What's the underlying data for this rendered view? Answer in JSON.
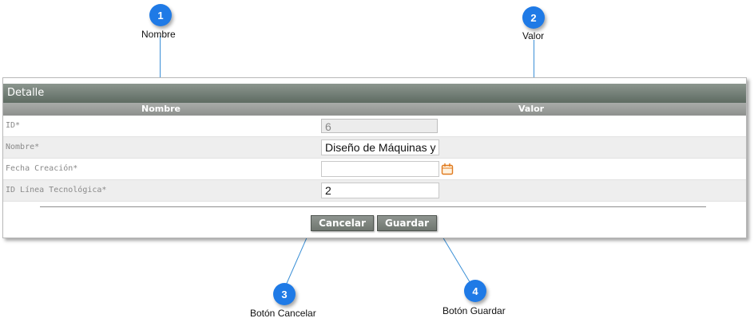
{
  "callouts": [
    {
      "number": "1",
      "label": "Nombre"
    },
    {
      "number": "2",
      "label": "Valor"
    },
    {
      "number": "3",
      "label": "Botón Cancelar"
    },
    {
      "number": "4",
      "label": "Botón Guardar"
    }
  ],
  "panel": {
    "title": "Detalle",
    "columns": {
      "name": "Nombre",
      "value": "Valor"
    }
  },
  "rows": [
    {
      "label": "ID*",
      "value": "6",
      "readonly": true
    },
    {
      "label": "Nombre*",
      "value": "Diseño de Máquinas y E"
    },
    {
      "label": "Fecha Creación*",
      "value": "",
      "icon": "calendar-icon"
    },
    {
      "label": "ID Línea Tecnológica*",
      "value": "2"
    }
  ],
  "buttons": {
    "cancel": "Cancelar",
    "save": "Guardar"
  },
  "colors": {
    "callout": "#1f7ae6",
    "header": "#6b766e",
    "calendar_icon": "#e07a1e"
  }
}
